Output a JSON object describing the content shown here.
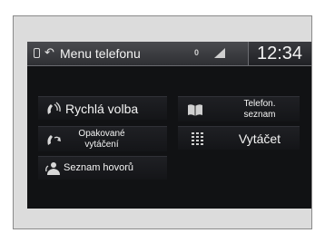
{
  "header": {
    "title": "Menu telefonu",
    "status": "0",
    "clock": "12:34"
  },
  "menu": {
    "speed_dial": "Rychlá volba",
    "redial_line1": "Opakované",
    "redial_line2": "vytáčení",
    "call_history": "Seznam hovorů",
    "phonebook_line1": "Telefon.",
    "phonebook_line2": "seznam",
    "dial": "Vytáčet"
  }
}
